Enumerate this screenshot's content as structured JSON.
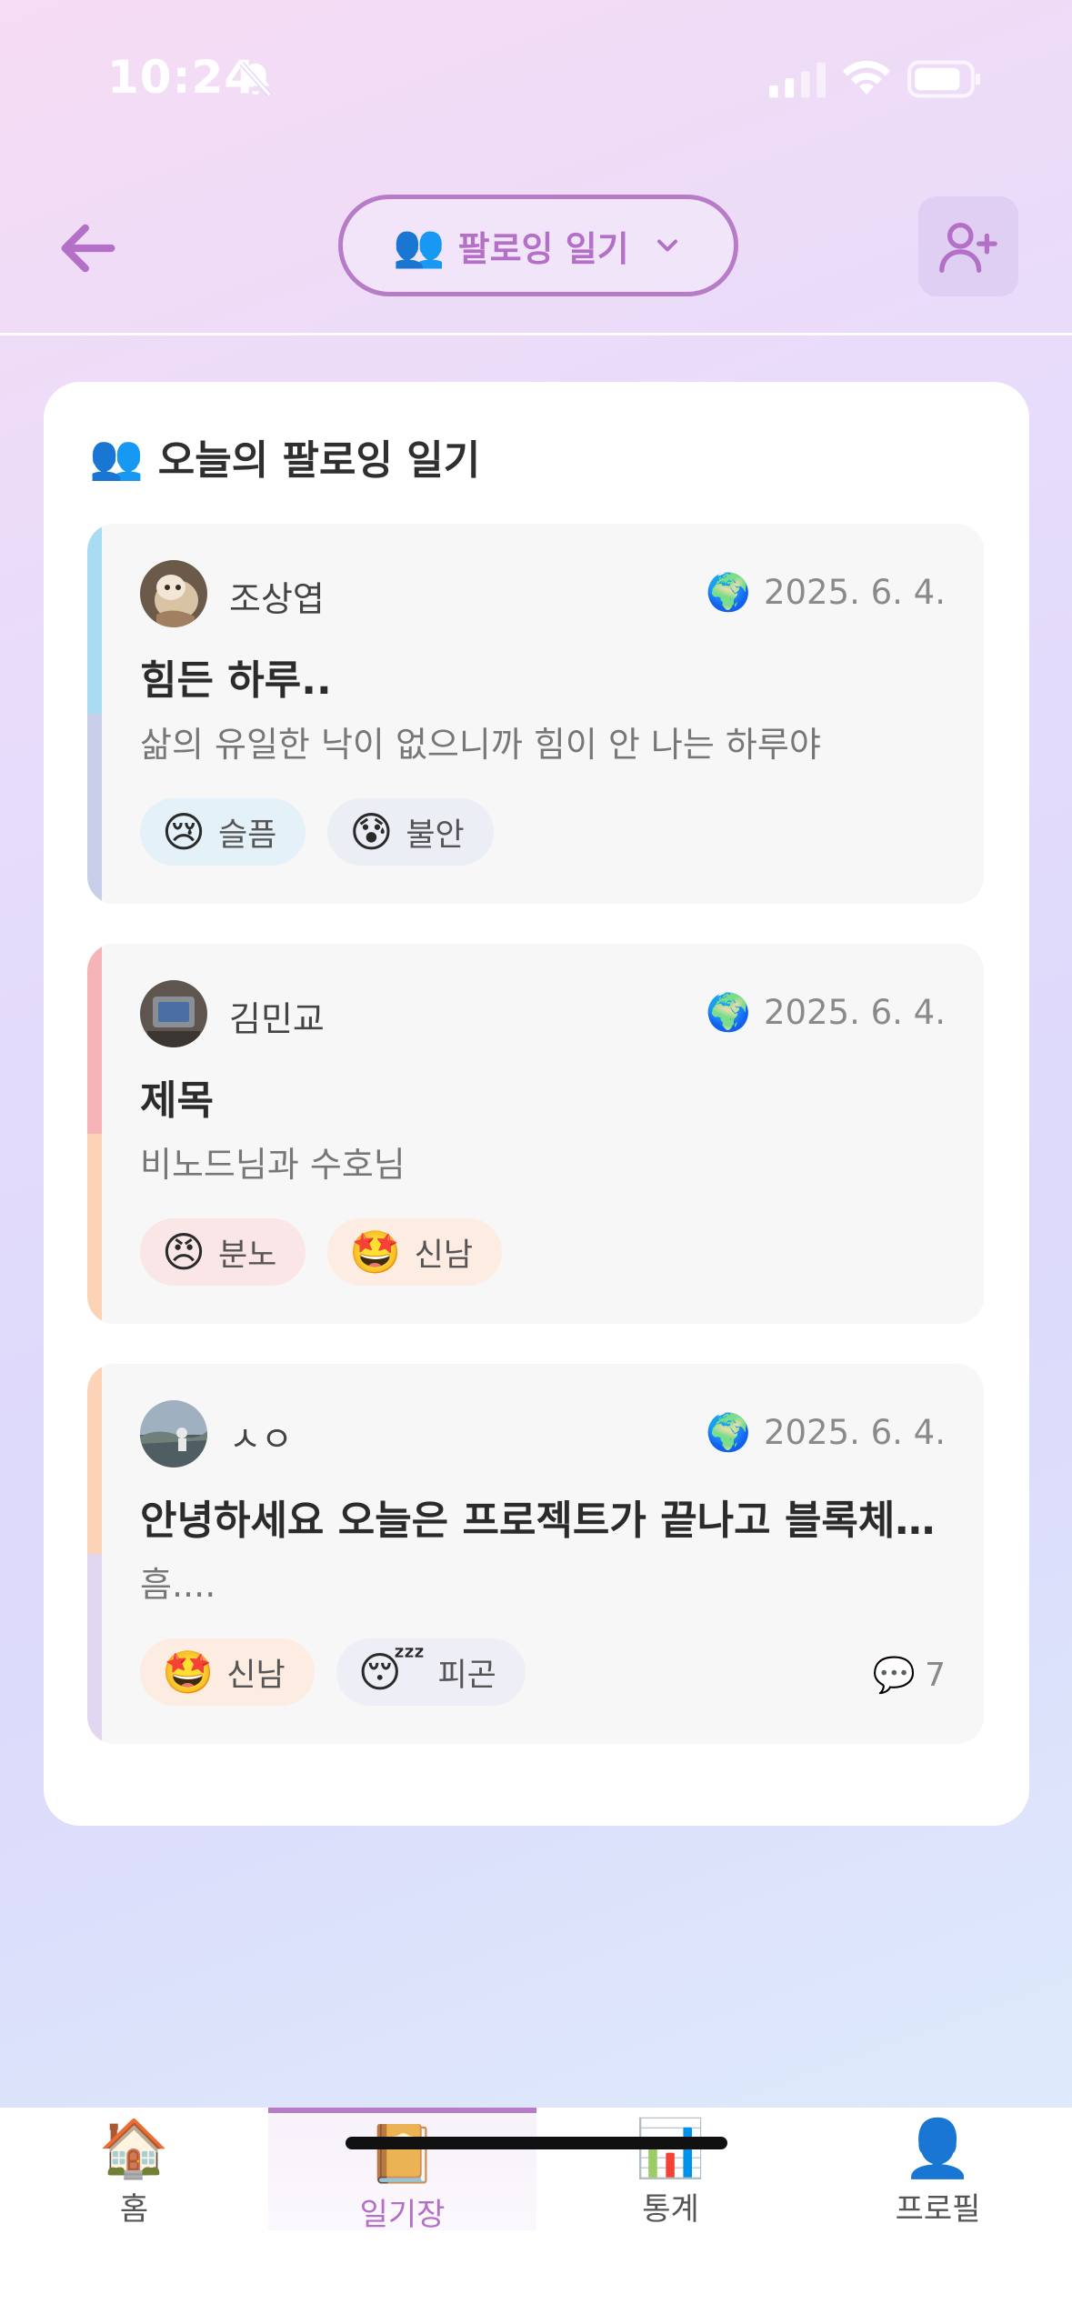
{
  "status_bar": {
    "time": "10:24"
  },
  "header": {
    "dropdown_emoji": "👥",
    "dropdown_label": "팔로잉 일기",
    "icons": [
      "back-arrow-icon",
      "chevron-down-icon",
      "add-user-icon"
    ]
  },
  "section": {
    "emoji": "👥",
    "title": "오늘의 팔로잉 일기"
  },
  "entries": [
    {
      "author": "조상엽",
      "visibility_icon": "🌍",
      "date": "2025. 6. 4.",
      "title": "힘든 하루..",
      "body": "삶의 유일한 낙이 없으니까 힘이 안 나는 하루야",
      "stripe_colors": [
        "#a8dcf2",
        "#c9cfe8"
      ],
      "tags": [
        {
          "emoji": "😢",
          "label": "슬픔",
          "bg": "#e4f1f8"
        },
        {
          "emoji": "😰",
          "label": "불안",
          "bg": "#eceef6"
        }
      ],
      "comments": null
    },
    {
      "author": "김민교",
      "visibility_icon": "🌍",
      "date": "2025. 6. 4.",
      "title": "제목",
      "body": "비노드님과 수호님",
      "stripe_colors": [
        "#f7b4b8",
        "#fdd3b8"
      ],
      "tags": [
        {
          "emoji": "😠",
          "label": "분노",
          "bg": "#fae6e6"
        },
        {
          "emoji": "🤩",
          "label": "신남",
          "bg": "#fcece2"
        }
      ],
      "comments": null
    },
    {
      "author": "ㅅㅇ",
      "visibility_icon": "🌍",
      "date": "2025. 6. 4.",
      "title": "안녕하세요 오늘은 프로젝트가 끝나고 블록체인…",
      "body": "흠....",
      "stripe_colors": [
        "#fdd3b8",
        "#e1d7f0"
      ],
      "tags": [
        {
          "emoji": "🤩",
          "label": "신남",
          "bg": "#fcece2"
        },
        {
          "emoji": "😴",
          "label": "피곤",
          "bg": "#eeeef6"
        }
      ],
      "comments": {
        "icon": "💬",
        "count": "7"
      }
    }
  ],
  "bottom_nav": [
    {
      "icon": "🏠",
      "label": "홈",
      "active": false
    },
    {
      "icon": "📔",
      "label": "일기장",
      "active": true
    },
    {
      "icon": "📊",
      "label": "통계",
      "active": false
    },
    {
      "icon": "👤",
      "label": "프로필",
      "active": false
    }
  ],
  "colors": {
    "accent": "#b46fc6",
    "accent_border": "#b77cc7"
  }
}
